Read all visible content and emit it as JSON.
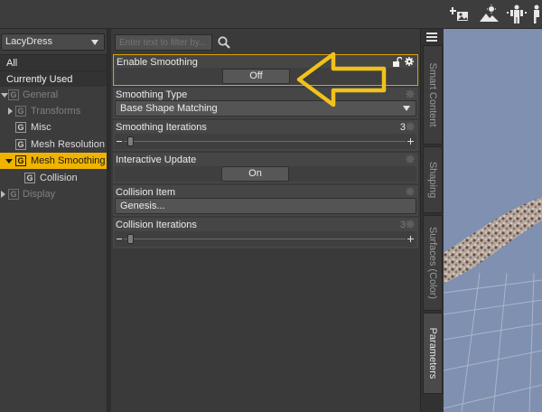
{
  "toolbar": {
    "icons": [
      "add-image-icon",
      "scene-light-icon",
      "figure-pose-icon",
      "figure-icon"
    ]
  },
  "left_pane": {
    "node_selector": "LacyDress",
    "filters": [
      "All",
      "Currently Used"
    ],
    "tree": [
      {
        "label": "General",
        "state": "dim",
        "toggle": "expanded"
      },
      {
        "label": "Transforms",
        "state": "dim",
        "toggle": "collapsed"
      },
      {
        "label": "Misc",
        "state": "normal"
      },
      {
        "label": "Mesh Resolution",
        "state": "normal"
      },
      {
        "label": "Mesh Smoothing",
        "state": "selected",
        "toggle": "expanded"
      },
      {
        "label": "Collision",
        "state": "normal"
      },
      {
        "label": "Display",
        "state": "dim",
        "toggle": "collapsed"
      }
    ],
    "group_glyph": "G"
  },
  "center_pane": {
    "filter_placeholder": "Enter text to filter by...",
    "params": {
      "enable_smoothing": {
        "label": "Enable Smoothing",
        "value": "Off"
      },
      "smoothing_type": {
        "label": "Smoothing Type",
        "value": "Base Shape Matching"
      },
      "smoothing_iterations": {
        "label": "Smoothing Iterations",
        "value": "3",
        "slider_fraction": 0.0
      },
      "interactive_update": {
        "label": "Interactive Update",
        "value": "On"
      },
      "collision_item": {
        "label": "Collision Item",
        "value": "Genesis..."
      },
      "collision_iterations": {
        "label": "Collision Iterations",
        "value": "3",
        "slider_fraction": 0.0
      }
    },
    "annotation_color": "#f2c21b",
    "highlight_color": "#d9a400"
  },
  "side_tabs": [
    {
      "label": "Smart Content",
      "active": false
    },
    {
      "label": "Shaping",
      "active": false
    },
    {
      "label": "Surfaces (Color)",
      "active": false
    },
    {
      "label": "Parameters",
      "active": true
    }
  ],
  "colors": {
    "selection": "#f0b400",
    "viewport": "#7f90b0"
  }
}
